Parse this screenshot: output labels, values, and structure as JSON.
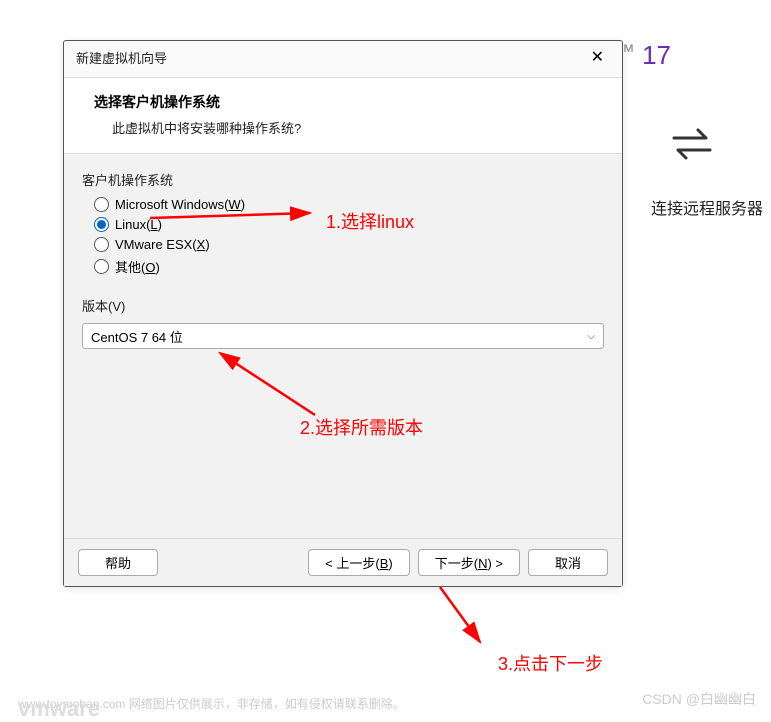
{
  "background": {
    "version_label": "17",
    "connect_label": "连接远程服务器"
  },
  "dialog": {
    "title": "新建虚拟机向导",
    "header": {
      "title": "选择客户机操作系统",
      "subtitle": "此虚拟机中将安装哪种操作系统?"
    },
    "os_group_label": "客户机操作系统",
    "os_options": [
      {
        "label": "Microsoft Windows(",
        "accel": "W",
        "suffix": ")",
        "selected": false
      },
      {
        "label": "Linux(",
        "accel": "L",
        "suffix": ")",
        "selected": true
      },
      {
        "label": "VMware ESX(",
        "accel": "X",
        "suffix": ")",
        "selected": false
      },
      {
        "label": "其他(",
        "accel": "O",
        "suffix": ")",
        "selected": false
      }
    ],
    "version_label_prefix": "版本(",
    "version_accel": "V",
    "version_label_suffix": ")",
    "version_selected": "CentOS 7 64 位",
    "buttons": {
      "help": "帮助",
      "back_prefix": "< 上一步(",
      "back_accel": "B",
      "back_suffix": ")",
      "next_prefix": "下一步(",
      "next_accel": "N",
      "next_suffix": ") >",
      "cancel": "取消"
    }
  },
  "annotations": {
    "step1": "1.选择linux",
    "step2": "2.选择所需版本",
    "step3": "3.点击下一步"
  },
  "watermarks": {
    "csdn": "CSDN @白幽幽白",
    "toymoban": "www.toymoban.com  网络图片仅供展示，非存储，如有侵权请联系删除。",
    "vmware": "vmware"
  }
}
